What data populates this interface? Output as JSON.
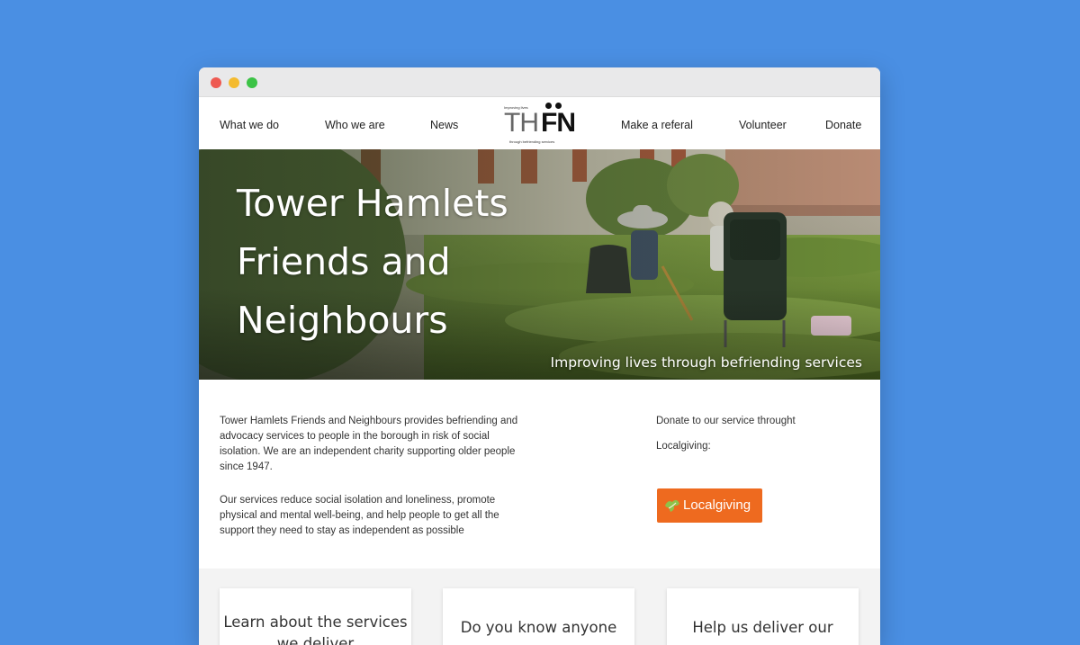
{
  "nav": {
    "items": [
      {
        "label": "What we do"
      },
      {
        "label": "Who we are"
      },
      {
        "label": "News"
      },
      {
        "label": "Make a referal"
      },
      {
        "label": "Volunteer"
      },
      {
        "label": "Donate"
      }
    ],
    "logo": {
      "small_top": "Improving lives",
      "letters_left": "TH",
      "letters_right": "FN",
      "small_bottom": "through befriending services"
    }
  },
  "hero": {
    "title_lines": [
      "Tower Hamlets",
      "Friends and",
      "Neighbours"
    ],
    "tagline": "Improving lives through befriending services"
  },
  "intro": {
    "paragraph1": "Tower Hamlets Friends and Neighbours provides befriending and advocacy services to people in the borough in risk of social isolation. We are an independent charity supporting older people since 1947.",
    "paragraph2": "Our services reduce social isolation and loneliness, promote physical and mental well-being, and help people to get all the support they need to stay as independent as possible"
  },
  "donate": {
    "line1": "Donate to our service throught",
    "line2": "Localgiving:",
    "button_label": "Localgiving",
    "button_icon": "puzzle-leaf-icon",
    "button_color": "#ee6a1f"
  },
  "cards": [
    {
      "title": "Learn about the services we deliver"
    },
    {
      "title": "Do you know anyone"
    },
    {
      "title": "Help us deliver our"
    }
  ],
  "colors": {
    "background": "#4a8fe3",
    "window_chrome": "#e9e9ea",
    "accent_orange": "#ee6a1f"
  }
}
